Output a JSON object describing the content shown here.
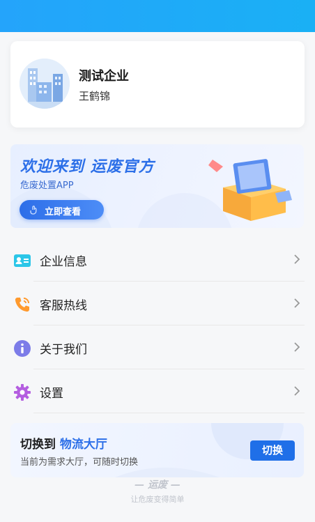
{
  "profile": {
    "company_name": "测试企业",
    "user_name": "王鹤锦"
  },
  "banner": {
    "title": "欢迎来到 运废官方",
    "subtitle": "危废处置APP",
    "button_label": "立即查看"
  },
  "menu": {
    "items": [
      {
        "label": "企业信息",
        "icon": "id-card-icon"
      },
      {
        "label": "客服热线",
        "icon": "phone-icon"
      },
      {
        "label": "关于我们",
        "icon": "info-icon"
      },
      {
        "label": "设置",
        "icon": "gear-icon"
      }
    ]
  },
  "switch_card": {
    "title_prefix": "切换到 ",
    "title_highlight": "物流大厅",
    "subtitle": "当前为需求大厅，可随时切换",
    "button_label": "切换"
  },
  "footer": {
    "logo_text": "运废",
    "slogan": "让危废变得简单"
  },
  "colors": {
    "accent": "#2c6fe8",
    "topbar": "#24a4fb"
  }
}
